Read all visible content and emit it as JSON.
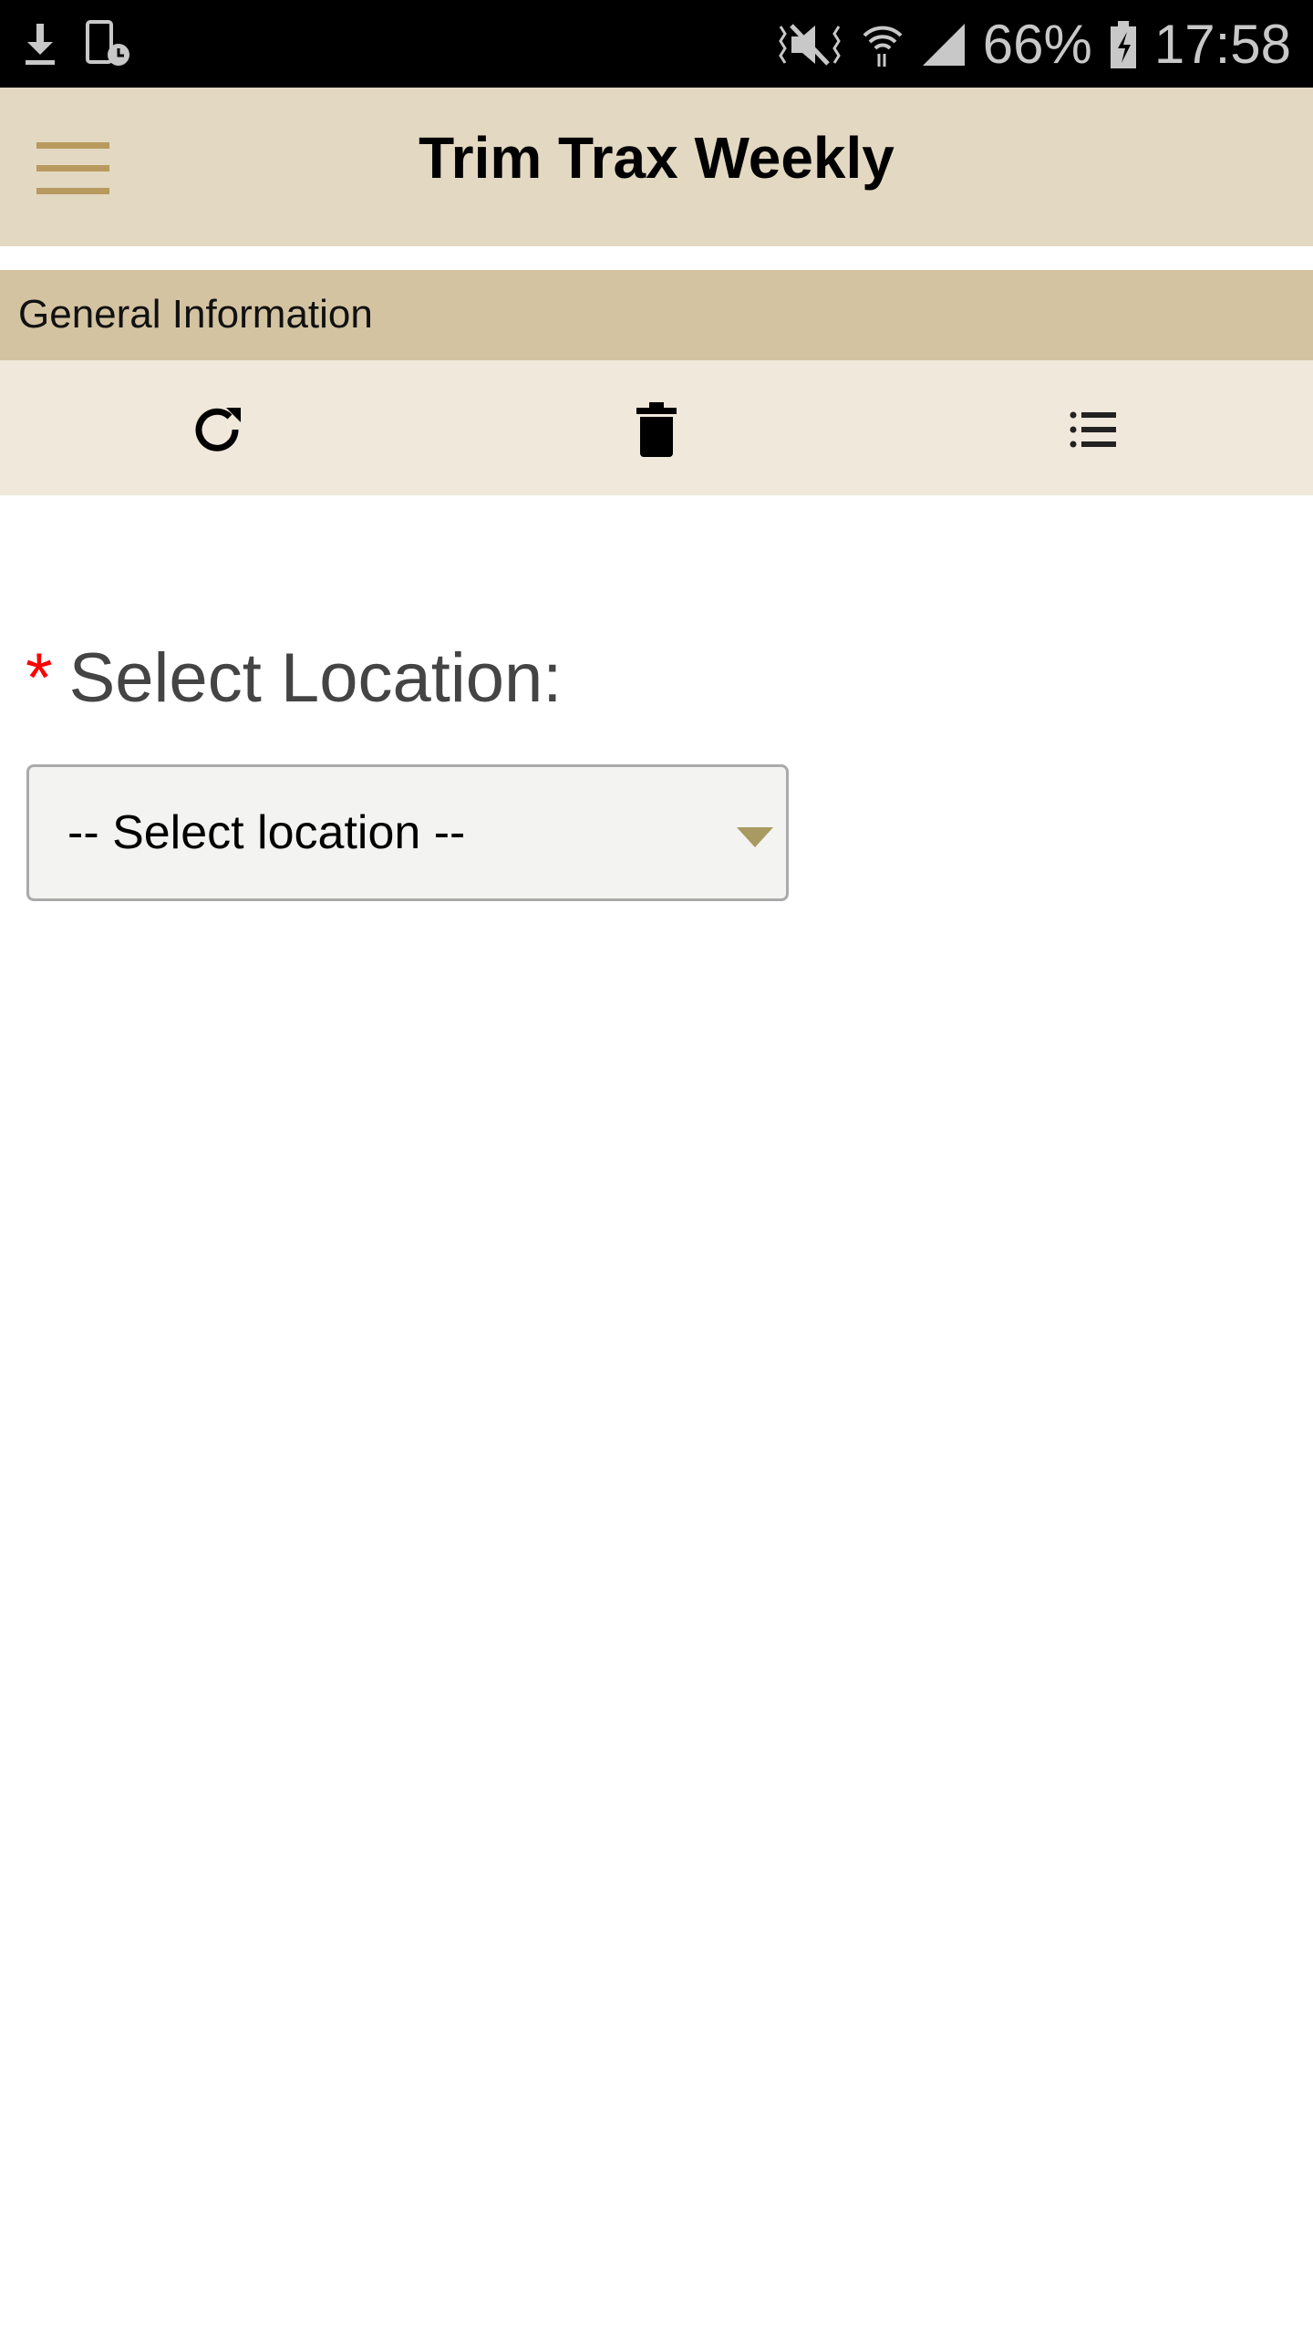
{
  "status_bar": {
    "battery": "66%",
    "time": "17:58",
    "icons": [
      "download-icon",
      "device-clock-icon",
      "vibrate-mute-icon",
      "wifi-icon",
      "signal-icon",
      "battery-charging-icon"
    ]
  },
  "header": {
    "title": "Trim Trax Weekly",
    "menu_icon": "hamburger-icon"
  },
  "section": {
    "title": "General Information"
  },
  "toolbar": {
    "icons": [
      "refresh-icon",
      "trash-icon",
      "list-icon"
    ]
  },
  "form": {
    "required_mark": "*",
    "label": "Select Location:",
    "select_value": "-- Select location --"
  },
  "colors": {
    "header_bg": "#e3d8c1",
    "section_bg": "#d3c3a1",
    "toolbar_bg": "#f0e8db",
    "accent": "#b89a5e",
    "required": "#ff0000"
  }
}
